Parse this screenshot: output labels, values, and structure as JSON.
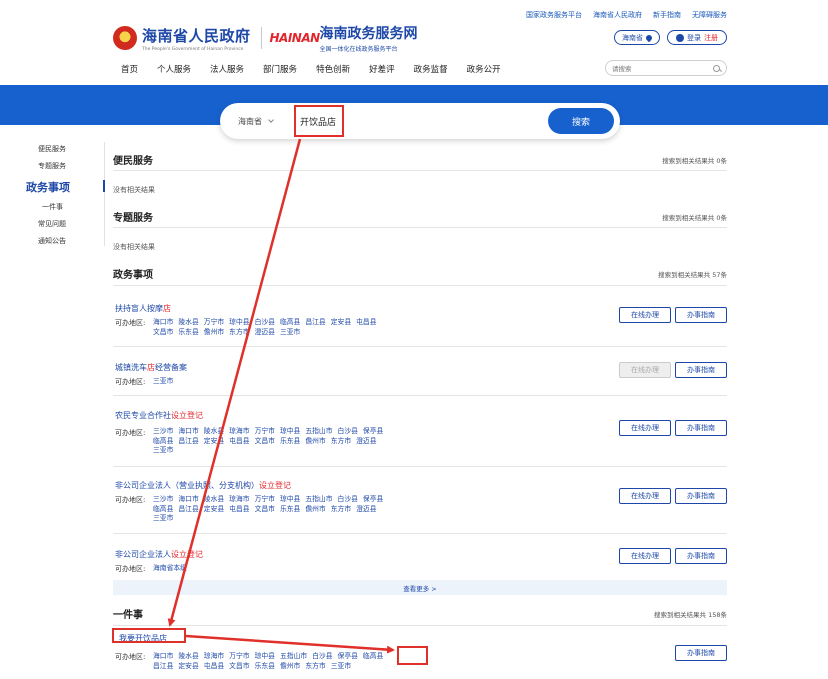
{
  "toplinks": [
    "国家政务服务平台",
    "海南省人民政府",
    "新手指南",
    "无障碍服务"
  ],
  "header": {
    "gov_name": "海南省人民政府",
    "gov_name_en": "The People's Government of Hainan Province",
    "brand_mark": "HAINAN",
    "service_name": "海南政务服务网",
    "service_sub": "全国一体化在线政务服务平台",
    "region_label": "海南省",
    "login_label": "登录",
    "register_label": "注册",
    "search_placeholder": "请搜索"
  },
  "nav": [
    "首页",
    "个人服务",
    "法人服务",
    "部门服务",
    "特色创新",
    "好差评",
    "政务监督",
    "政务公开"
  ],
  "search": {
    "region": "海南省",
    "query": "开饮品店",
    "button": "搜索"
  },
  "sidebar": {
    "items": [
      "便民服务",
      "专题服务",
      "政务事项",
      "一件事",
      "常见问题",
      "通知公告"
    ],
    "active": "政务事项"
  },
  "sections": {
    "bianmin": {
      "title": "便民服务",
      "count": "搜索到相关结果共 0条",
      "empty": "没有相关结果"
    },
    "zhuanti": {
      "title": "专题服务",
      "count": "搜索到相关结果共 0条",
      "empty": "没有相关结果"
    },
    "zhengwu": {
      "title": "政务事项",
      "count": "搜索到相关结果共 57条"
    },
    "yijianshi": {
      "title": "一件事",
      "count": "搜索到相关结果共 158条"
    }
  },
  "area_label": "可办地区:",
  "buttons": {
    "online": "在线办理",
    "guide": "办事指南"
  },
  "items": [
    {
      "title_pre": "扶持盲人按摩",
      "title_hl": "店",
      "title_post": "",
      "areas": [
        "海口市",
        "陵水县",
        "万宁市",
        "琼中县",
        "白沙县",
        "临高县",
        "昌江县",
        "定安县",
        "屯昌县",
        "文昌市",
        "乐东县",
        "儋州市",
        "东方市",
        "澄迈县",
        "三亚市"
      ]
    },
    {
      "title_pre": "城镇洗车",
      "title_hl": "店",
      "title_post": "经营备案",
      "areas": [
        "三亚市"
      ]
    },
    {
      "title_pre": "农民专业合作社",
      "title_hl": "设立登记",
      "title_post": "",
      "areas": [
        "三沙市",
        "海口市",
        "陵水县",
        "琼海市",
        "万宁市",
        "琼中县",
        "五指山市",
        "白沙县",
        "保亭县",
        "临高县",
        "昌江县",
        "定安县",
        "屯昌县",
        "文昌市",
        "乐东县",
        "儋州市",
        "东方市",
        "澄迈县",
        "三亚市"
      ]
    },
    {
      "title_pre": "非公司企业法人（营业执照、分支机构）",
      "title_hl": "设立登记",
      "title_post": "",
      "areas": [
        "三沙市",
        "海口市",
        "陵水县",
        "琼海市",
        "万宁市",
        "琼中县",
        "五指山市",
        "白沙县",
        "保亭县",
        "临高县",
        "昌江县",
        "定安县",
        "屯昌县",
        "文昌市",
        "乐东县",
        "儋州市",
        "东方市",
        "澄迈县",
        "三亚市"
      ]
    },
    {
      "title_pre": "非公司企业法人",
      "title_hl": "设立登记",
      "title_post": "",
      "areas": [
        "海南省本级"
      ]
    }
  ],
  "more": "查看更多 >",
  "yijianshi_item": {
    "title": "我要开饮品店",
    "areas": [
      "海口市",
      "陵水县",
      "琼海市",
      "万宁市",
      "琼中县",
      "五指山市",
      "白沙县",
      "保亭县",
      "临高县",
      "昌江县",
      "定安县",
      "屯昌县",
      "文昌市",
      "乐东县",
      "儋州市",
      "东方市",
      "三亚市"
    ]
  },
  "colors": {
    "primary": "#1761cf",
    "brand": "#1e48a8",
    "highlight": "#e1262d",
    "annotation": "#e0302a"
  }
}
